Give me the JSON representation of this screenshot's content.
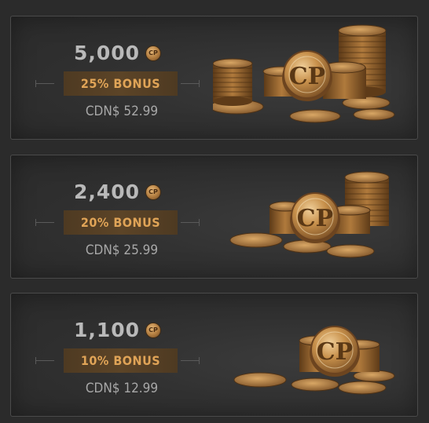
{
  "offers": [
    {
      "amount": "5,000",
      "currency_icon": "cp-coin-icon",
      "bonus": "25% BONUS",
      "price": "CDN$ 52.99"
    },
    {
      "amount": "2,400",
      "currency_icon": "cp-coin-icon",
      "bonus": "20% BONUS",
      "price": "CDN$ 25.99"
    },
    {
      "amount": "1,100",
      "currency_icon": "cp-coin-icon",
      "bonus": "10% BONUS",
      "price": "CDN$ 12.99"
    }
  ],
  "coin_badge_text": "CP",
  "colors": {
    "bonus_text": "#e0a457",
    "bonus_bg": "#5c4427",
    "amount_text": "#b9b9b9",
    "price_text": "#a8a8a8",
    "card_border": "#4a4a4a"
  }
}
